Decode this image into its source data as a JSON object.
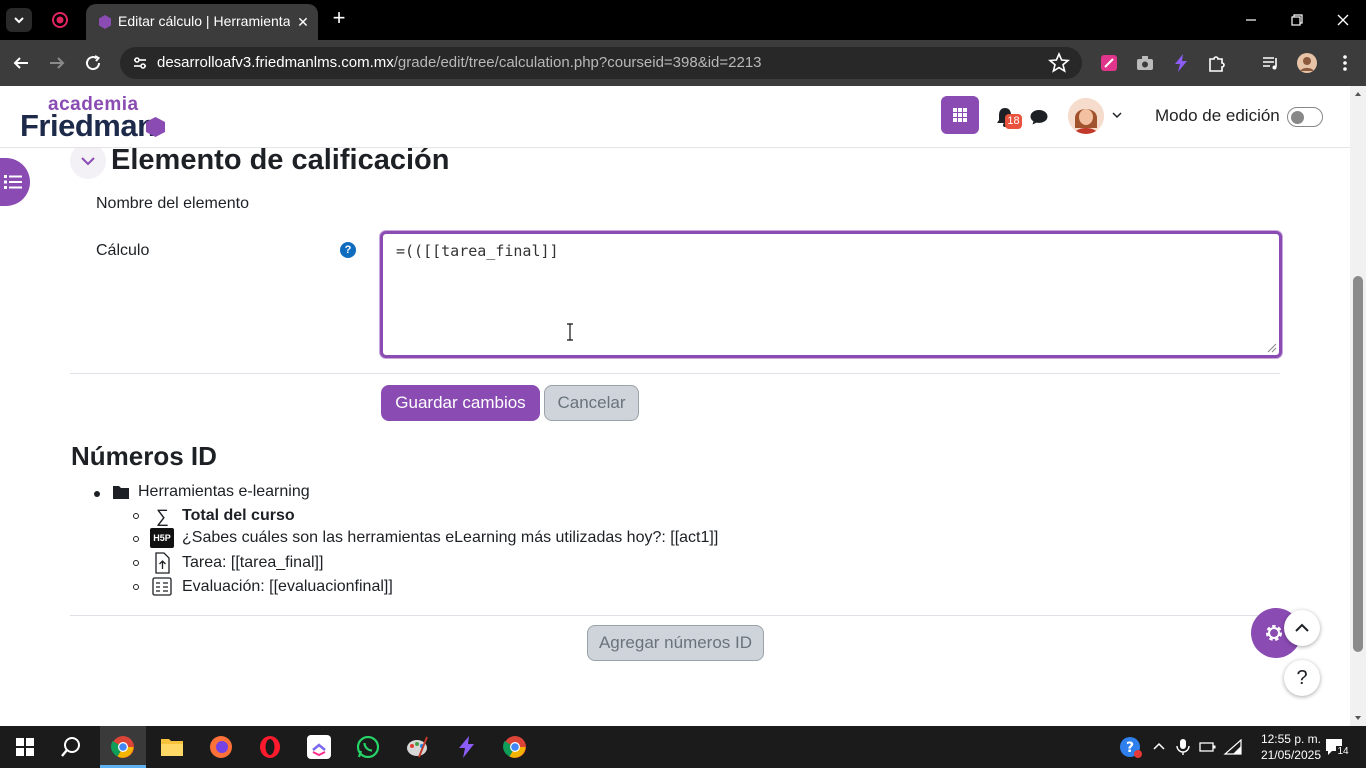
{
  "browser": {
    "tab_title": "Editar cálculo | Herramientas e-learning",
    "url_domain": "desarrolloafv3.friedmanlms.com.mx",
    "url_path": "/grade/edit/tree/calculation.php?courseid=398&id=2213"
  },
  "header": {
    "logo_top": "academia",
    "logo_bottom": "Friedman",
    "notification_count": "18",
    "edit_mode_label": "Modo de edición",
    "edit_mode_on": false
  },
  "form": {
    "section_title": "Elemento de calificación",
    "item_name_label": "Nombre del elemento",
    "calc_label": "Cálculo",
    "calc_value": "=(([[tarea_final]]",
    "save_label": "Guardar cambios",
    "cancel_label": "Cancelar"
  },
  "ids": {
    "title": "Números ID",
    "category": "Herramientas e-learning",
    "items": [
      {
        "icon": "sigma-icon",
        "text": "Total del curso",
        "bold": true
      },
      {
        "icon": "h5p-icon",
        "text": "¿Sabes cuáles son las herramientas eLearning más utilizadas hoy?: [[act1]]",
        "bold": false
      },
      {
        "icon": "assignment-upload-icon",
        "text": "Tarea: [[tarea_final]]",
        "bold": false
      },
      {
        "icon": "quiz-icon",
        "text": "Evaluación: [[evaluacionfinal]]",
        "bold": false
      }
    ],
    "add_button_label": "Agregar números ID"
  },
  "taskbar": {
    "time": "12:55 p. m.",
    "date": "21/05/2025",
    "notifications": "14"
  },
  "colors": {
    "brand_purple": "#8a4bb3",
    "logo_navy": "#1d2a4a"
  }
}
